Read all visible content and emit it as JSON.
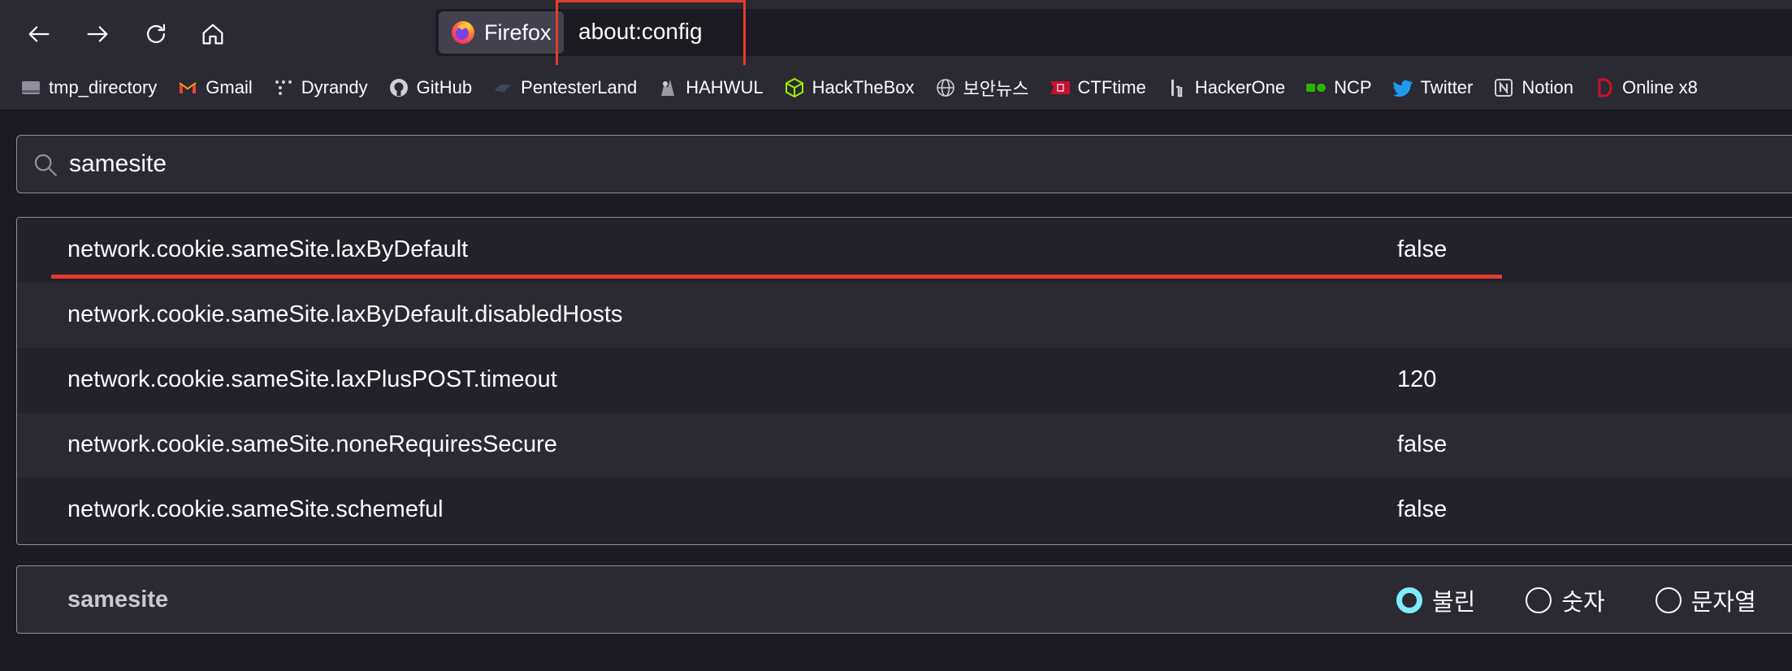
{
  "browser": {
    "identity_label": "Firefox",
    "url": "about:config"
  },
  "nav_icons": [
    "back-icon",
    "forward-icon",
    "reload-icon",
    "home-icon"
  ],
  "bookmarks": [
    {
      "label": "tmp_directory",
      "icon": "folder-icon"
    },
    {
      "label": "Gmail",
      "icon": "gmail-icon"
    },
    {
      "label": "Dyrandy",
      "icon": "dyrandy-icon"
    },
    {
      "label": "GitHub",
      "icon": "github-icon"
    },
    {
      "label": "PentesterLand",
      "icon": "pentesterland-icon"
    },
    {
      "label": "HAHWUL",
      "icon": "hahwul-icon"
    },
    {
      "label": "HackTheBox",
      "icon": "hackthebox-icon"
    },
    {
      "label": "보안뉴스",
      "icon": "globe-icon"
    },
    {
      "label": "CTFtime",
      "icon": "ctftime-icon"
    },
    {
      "label": "HackerOne",
      "icon": "hackerone-icon"
    },
    {
      "label": "NCP",
      "icon": "ncp-icon"
    },
    {
      "label": "Twitter",
      "icon": "twitter-icon"
    },
    {
      "label": "Notion",
      "icon": "notion-icon"
    },
    {
      "label": "Online x8",
      "icon": "online-icon"
    }
  ],
  "search": {
    "value": "samesite"
  },
  "prefs": [
    {
      "name": "network.cookie.sameSite.laxByDefault",
      "value": "false"
    },
    {
      "name": "network.cookie.sameSite.laxByDefault.disabledHosts",
      "value": ""
    },
    {
      "name": "network.cookie.sameSite.laxPlusPOST.timeout",
      "value": "120"
    },
    {
      "name": "network.cookie.sameSite.noneRequiresSecure",
      "value": "false"
    },
    {
      "name": "network.cookie.sameSite.schemeful",
      "value": "false"
    }
  ],
  "add_pref": {
    "name": "samesite",
    "types": [
      {
        "label": "불린",
        "checked": true
      },
      {
        "label": "숫자",
        "checked": false
      },
      {
        "label": "문자열",
        "checked": false
      }
    ]
  },
  "colors": {
    "highlight": "#e33b2e",
    "accent": "#80ebff",
    "toolbar": "#2b2a33",
    "content": "#1c1b22"
  }
}
